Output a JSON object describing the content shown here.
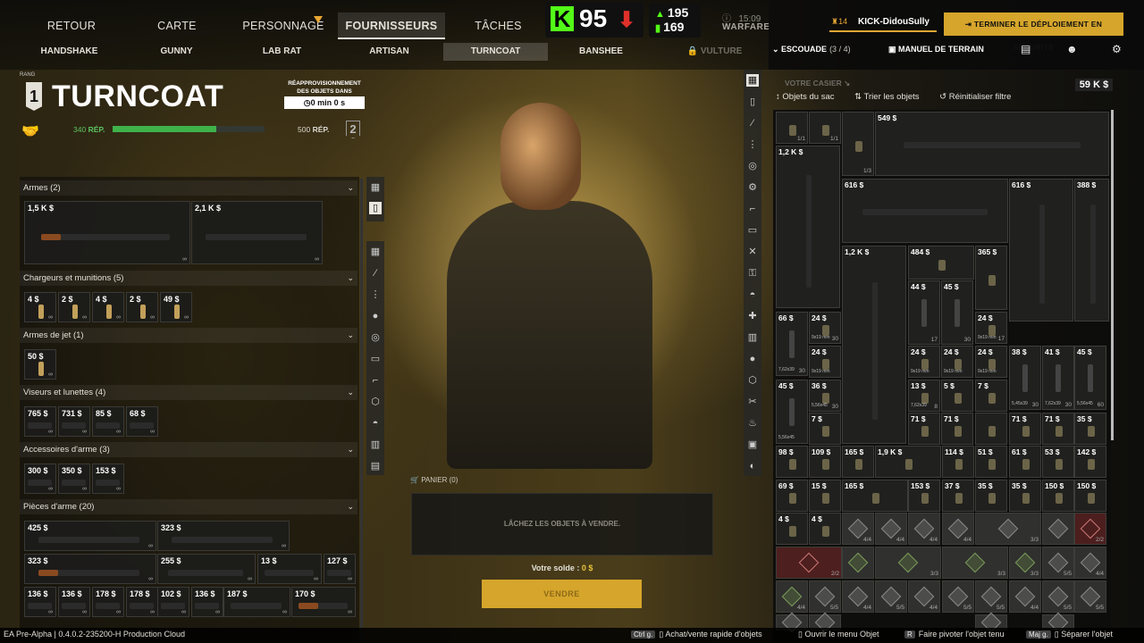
{
  "top_nav": {
    "tabs": [
      "RETOUR",
      "CARTE",
      "PERSONNAGE",
      "FOURNISSEURS",
      "TÂCHES"
    ],
    "active": "FOURNISSEURS"
  },
  "trader_tabs": [
    "HANDSHAKE",
    "GUNNY",
    "LAB RAT",
    "ARTISAN",
    "TURNCOAT",
    "BANSHEE",
    "VULTURE"
  ],
  "trader": {
    "rank_label": "RANG",
    "rank": "1",
    "name": "TURNCOAT",
    "restock_label": "RÉAPPROVISIONNEMENT DES OBJETS DANS",
    "restock_time": "0 min 0 s",
    "rep_current": "340",
    "rep_unit": "RÉP.",
    "rep_max": "500",
    "rep_progress": 0.68,
    "next_rank": "2"
  },
  "stream_overlay": {
    "k_logo": "K",
    "viewers": "95",
    "stat1": "195",
    "stat2": "169",
    "time": "15:09",
    "mode": "WARFARE"
  },
  "player": {
    "level": "14",
    "name": "KICK-DidouSully",
    "deploy_label": "TERMINER LE DÉPLOIEMENT EN SÉCURITÉ",
    "squad_label": "ESCOUADE",
    "squad_count": "(3 / 4)",
    "manual_label": "MANUEL DE TERRAIN"
  },
  "categories": [
    {
      "name": "Armes (2)",
      "items": [
        "1,5 K $",
        "2,1 K $"
      ]
    },
    {
      "name": "Chargeurs et munitions (5)",
      "items": [
        "4 $",
        "2 $",
        "4 $",
        "2 $",
        "49 $"
      ]
    },
    {
      "name": "Armes de jet (1)",
      "items": [
        "50 $"
      ]
    },
    {
      "name": "Viseurs et lunettes (4)",
      "items": [
        "765 $",
        "731 $",
        "85 $",
        "68 $"
      ]
    },
    {
      "name": "Accessoires d'arme (3)",
      "items": [
        "300 $",
        "350 $",
        "153 $"
      ]
    },
    {
      "name": "Pièces d'arme (20)",
      "items": [
        "425 $",
        "323 $",
        "323 $",
        "255 $",
        "13 $",
        "127 $",
        "136 $",
        "136 $",
        "178 $",
        "178 $",
        "102 $",
        "136 $",
        "187 $",
        "170 $"
      ]
    }
  ],
  "infinite": "∞",
  "basket": {
    "header": "PANIER (0)",
    "drop_msg": "LÂCHEZ LES OBJETS À VENDRE.",
    "balance_label": "Votre solde :",
    "balance_value": "0 $",
    "sell_label": "VENDRE"
  },
  "stash": {
    "title": "VOTRE CASIER",
    "value": "59 K $",
    "tools": [
      "Objets du sac",
      "Trier les objets",
      "Réinitialiser filtre"
    ],
    "prices": [
      "549 $",
      "1,2 K $",
      "616 $",
      "616 $",
      "388 $",
      "1,2 K $",
      "484 $",
      "365 $",
      "44 $",
      "45 $",
      "66 $",
      "24 $",
      "24 $",
      "24 $",
      "24 $",
      "24 $",
      "24 $",
      "38 $",
      "41 $",
      "45 $",
      "45 $",
      "36 $",
      "13 $",
      "5 $",
      "7 $",
      "7 $",
      "71 $",
      "71 $",
      "71 $",
      "71 $",
      "35 $",
      "98 $",
      "109 $",
      "165 $",
      "1,9 K $",
      "114 $",
      "51 $",
      "61 $",
      "53 $",
      "142 $",
      "69 $",
      "15 $",
      "165 $",
      "153 $",
      "37 $",
      "35 $",
      "35 $",
      "150 $",
      "150 $",
      "4 $",
      "4 $"
    ],
    "ammo_labels": [
      "9x19 mm",
      "5,45x39",
      "7,62x39",
      "5,56x45"
    ],
    "counts": [
      "1/1",
      "1/1",
      "1/3",
      "17",
      "30",
      "30",
      "30",
      "17",
      "30",
      "30",
      "60",
      "30",
      "8",
      "30",
      "1/1",
      "4/4",
      "4/4",
      "4/4",
      "4/4",
      "3/3",
      "5/5",
      "2/2",
      "2/2",
      "3/3",
      "3/3",
      "3/3",
      "5/5",
      "4/4",
      "5/5"
    ]
  },
  "hints": [
    {
      "key": "Ctrl g.",
      "label": "Achat/vente rapide d'objets"
    },
    {
      "key": "",
      "label": "Ouvrir le menu Objet"
    },
    {
      "key": "R",
      "label": "Faire pivoter l'objet tenu"
    },
    {
      "key": "Maj g.",
      "label": "Séparer l'objet"
    }
  ],
  "version": "EA Pre-Alpha | 0.4.0.2-235200-H Production Cloud"
}
